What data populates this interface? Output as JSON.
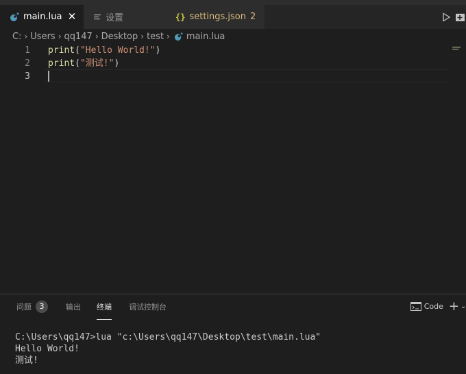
{
  "tabs": [
    {
      "label": "main.lua",
      "icon": "lua-icon",
      "active": true
    },
    {
      "label": "设置",
      "icon": "settings-file-icon",
      "active": false
    },
    {
      "label": "settings.json",
      "badge": "2",
      "icon": "json-braces-icon",
      "active": false
    }
  ],
  "tab_actions": {
    "run": "play-icon",
    "split": "split-editor-icon"
  },
  "breadcrumb": [
    "C:",
    "Users",
    "qq147",
    "Desktop",
    "test",
    "main.lua"
  ],
  "editor": {
    "lines": [
      {
        "number": "1",
        "fn": "print",
        "open": "(",
        "str": "\"Hello World!\"",
        "close": ")"
      },
      {
        "number": "2",
        "fn": "print",
        "open": "(",
        "str": "\"测试!\"",
        "close": ")"
      },
      {
        "number": "3",
        "fn": "",
        "open": "",
        "str": "",
        "close": ""
      }
    ]
  },
  "panel": {
    "tabs": [
      {
        "label": "问题",
        "badge": "3",
        "active": false
      },
      {
        "label": "输出",
        "active": false
      },
      {
        "label": "终端",
        "active": true
      },
      {
        "label": "调试控制台",
        "active": false
      }
    ],
    "terminal_selector": "Code",
    "add_terminal": "+"
  },
  "terminal": {
    "lines": [
      "C:\\Users\\qq147>lua \"c:\\Users\\qq147\\Desktop\\test\\main.lua\"",
      "Hello World!",
      "测试!"
    ]
  },
  "colors": {
    "lua": "#519aba",
    "json": "#cbcb41",
    "settings_json_text": "#d7ba7d",
    "accent": "#e7e7e7"
  }
}
